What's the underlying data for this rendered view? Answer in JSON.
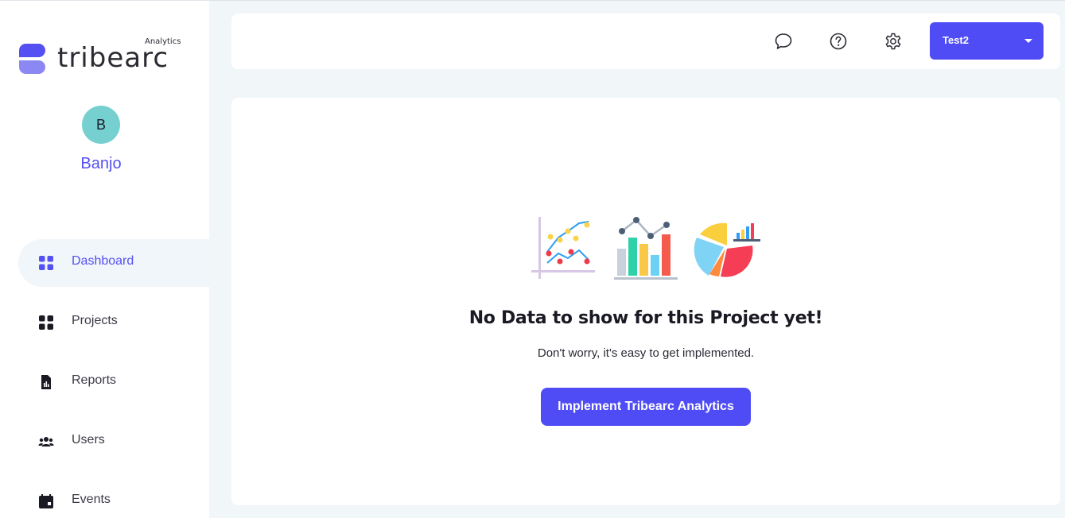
{
  "brand": {
    "name": "tribearc",
    "sub": "Analytics",
    "primary_color": "#5550f2",
    "secondary_color": "#8b88f4"
  },
  "user": {
    "initial": "B",
    "name": "Banjo",
    "avatar_color": "#76d0d0"
  },
  "sidebar": {
    "items": [
      {
        "label": "Dashboard",
        "icon": "dashboard-grid-icon",
        "active": true
      },
      {
        "label": "Projects",
        "icon": "projects-grid-icon",
        "active": false
      },
      {
        "label": "Reports",
        "icon": "report-document-icon",
        "active": false
      },
      {
        "label": "Users",
        "icon": "users-group-icon",
        "active": false
      },
      {
        "label": "Events",
        "icon": "calendar-icon",
        "active": false
      }
    ]
  },
  "header": {
    "icons": [
      "chat-bubble-icon",
      "help-circle-icon",
      "settings-gear-icon"
    ],
    "project_selector": {
      "value": "Test2"
    }
  },
  "main": {
    "empty_title": "No Data to show for this Project yet!",
    "empty_subtitle": "Don't worry, it's easy to get implemented.",
    "cta_label": "Implement Tribearc Analytics",
    "illustration": [
      "line-chart-icon",
      "bar-chart-icon",
      "pie-chart-icon"
    ]
  }
}
